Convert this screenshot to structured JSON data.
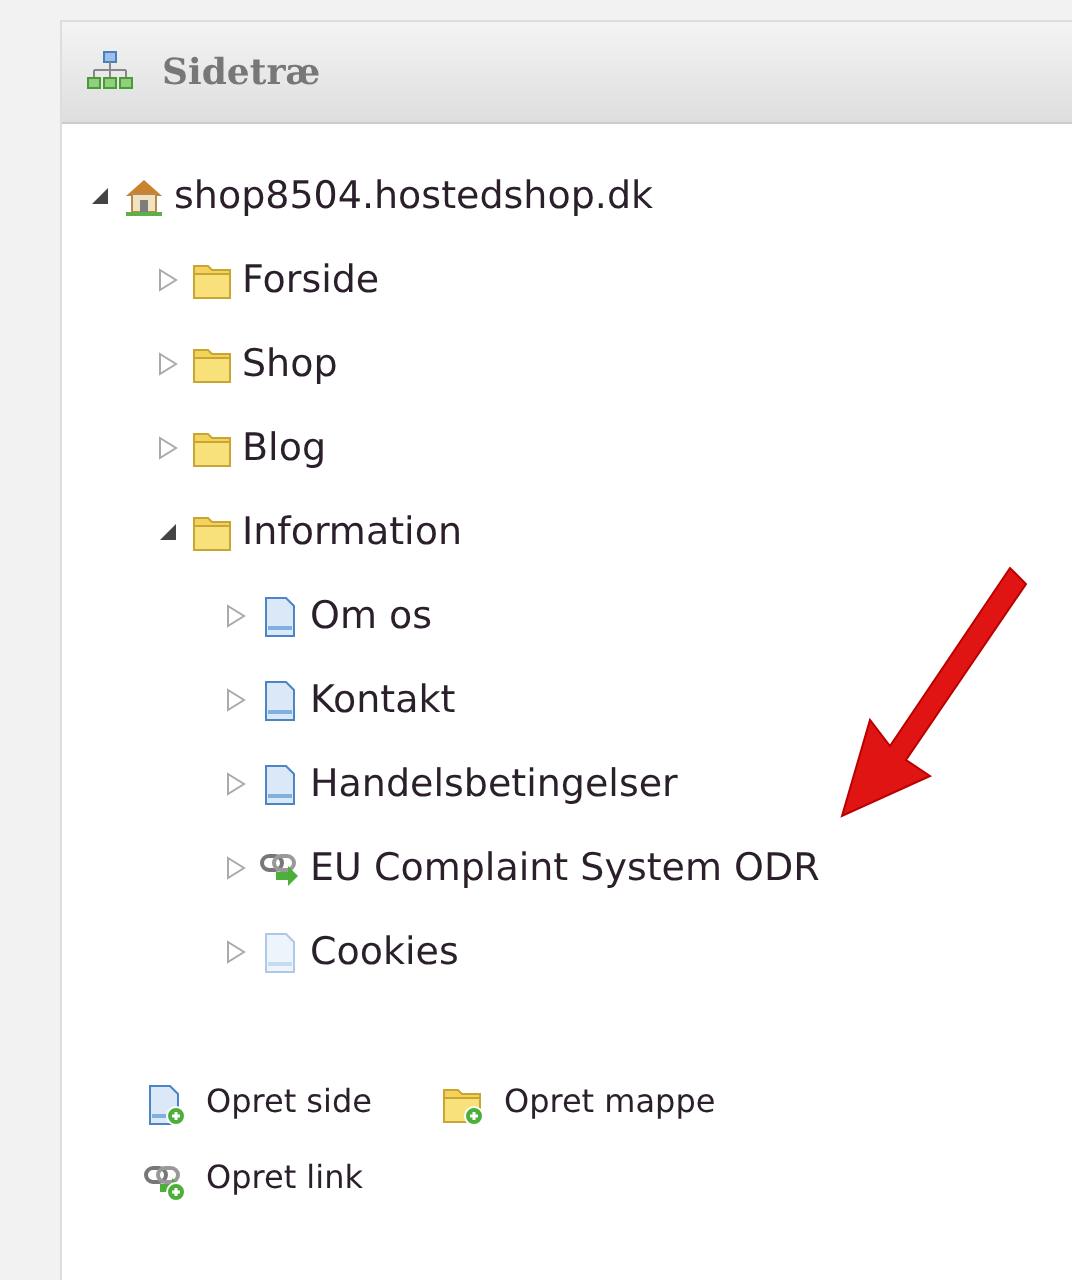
{
  "panel": {
    "title": "Sidetræ"
  },
  "tree": [
    {
      "label": "shop8504.hostedshop.dk",
      "kind": "site",
      "expanded": true,
      "inactive": false,
      "children": [
        {
          "label": "Forside",
          "kind": "folder",
          "expanded": false,
          "inactive": false
        },
        {
          "label": "Shop",
          "kind": "folder",
          "expanded": false,
          "inactive": false
        },
        {
          "label": "Blog",
          "kind": "folder",
          "expanded": false,
          "inactive": false
        },
        {
          "label": "Information",
          "kind": "folder",
          "expanded": true,
          "inactive": false,
          "children": [
            {
              "label": "Om os",
              "kind": "page",
              "expanded": false,
              "inactive": false
            },
            {
              "label": "Kontakt",
              "kind": "page",
              "expanded": false,
              "inactive": false
            },
            {
              "label": "Handelsbetingelser",
              "kind": "page",
              "expanded": false,
              "inactive": false
            },
            {
              "label": "EU Complaint System ODR",
              "kind": "link",
              "expanded": false,
              "inactive": false
            },
            {
              "label": "Cookies",
              "kind": "page",
              "expanded": false,
              "inactive": true
            }
          ]
        }
      ]
    }
  ],
  "actions": [
    {
      "label": "Opret side",
      "kind": "page"
    },
    {
      "label": "Opret mappe",
      "kind": "folder"
    },
    {
      "label": "Opret link",
      "kind": "link"
    }
  ]
}
